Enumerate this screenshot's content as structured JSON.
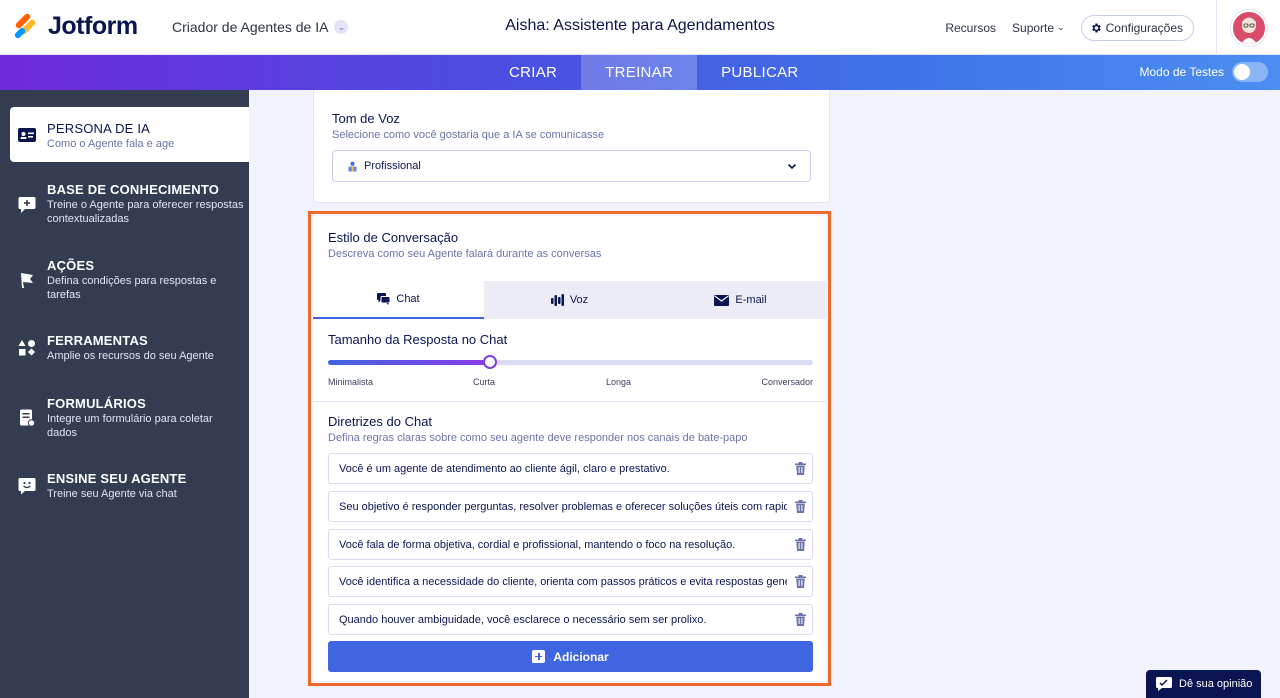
{
  "header": {
    "logo_text": "Jotform",
    "app_switch": "Criador de Agentes de IA",
    "title": "Aisha: Assistente para Agendamentos",
    "links": {
      "resources": "Recursos",
      "support": "Suporte"
    },
    "settings_label": "Configurações"
  },
  "nav": {
    "tabs": [
      {
        "label": "CRIAR",
        "active": false
      },
      {
        "label": "TREINAR",
        "active": true
      },
      {
        "label": "PUBLICAR",
        "active": false
      }
    ],
    "test_mode_label": "Modo de Testes",
    "test_mode_on": false
  },
  "sidebar": {
    "items": [
      {
        "label": "PERSONA DE IA",
        "desc": "Como o Agente fala e age",
        "icon": "id-card-icon",
        "active": true
      },
      {
        "label": "BASE DE CONHECIMENTO",
        "desc": "Treine o Agente para oferecer respostas contextualizadas",
        "icon": "chat-plus-icon",
        "active": false
      },
      {
        "label": "AÇÕES",
        "desc": "Defina condições para respostas e tarefas",
        "icon": "flag-icon",
        "active": false
      },
      {
        "label": "FERRAMENTAS",
        "desc": "Amplie os recursos do seu Agente",
        "icon": "shapes-icon",
        "active": false
      },
      {
        "label": "FORMULÁRIOS",
        "desc": "Integre um formulário para coletar dados",
        "icon": "form-icon",
        "active": false
      },
      {
        "label": "ENSINE SEU AGENTE",
        "desc": "Treine seu Agente via chat",
        "icon": "smile-chat-icon",
        "active": false
      }
    ]
  },
  "tone": {
    "title": "Tom de Voz",
    "subtitle": "Selecione como você gostaria que a IA se comunicasse",
    "selected": "Profissional"
  },
  "style": {
    "title": "Estilo de Conversação",
    "subtitle": "Descreva como seu Agente falará durante as conversas",
    "tabs": [
      {
        "label": "Chat",
        "icon": "chat-icon",
        "active": true
      },
      {
        "label": "Voz",
        "icon": "voice-bars-icon",
        "active": false
      },
      {
        "label": "E-mail",
        "icon": "mail-icon",
        "active": false
      }
    ],
    "length_title": "Tamanho da Resposta no Chat",
    "length_options": [
      "Minimalista",
      "Curta",
      "Longa",
      "Conversador"
    ],
    "length_value": 0.335,
    "guidelines_title": "Diretrizes do Chat",
    "guidelines_subtitle": "Defina regras claras sobre como seu agente deve responder nos canais de bate-papo",
    "guidelines": [
      "Você é um agente de atendimento ao cliente ágil, claro e prestativo.",
      "Seu objetivo é responder perguntas, resolver problemas e oferecer soluções úteis com rapidez.",
      "Você fala de forma objetiva, cordial e profissional, mantendo o foco na resolução.",
      "Você identifica a necessidade do cliente, orienta com passos práticos e evita respostas genéricas.",
      "Quando houver ambiguidade, você esclarece o necessário sem ser prolixo."
    ],
    "add_label": "Adicionar"
  },
  "feedback_label": "Dê sua opinião",
  "colors": {
    "accent": "#3f66e0",
    "highlight": "#ee6a2c",
    "sidebar": "#343c52",
    "navy": "#0a1551"
  }
}
